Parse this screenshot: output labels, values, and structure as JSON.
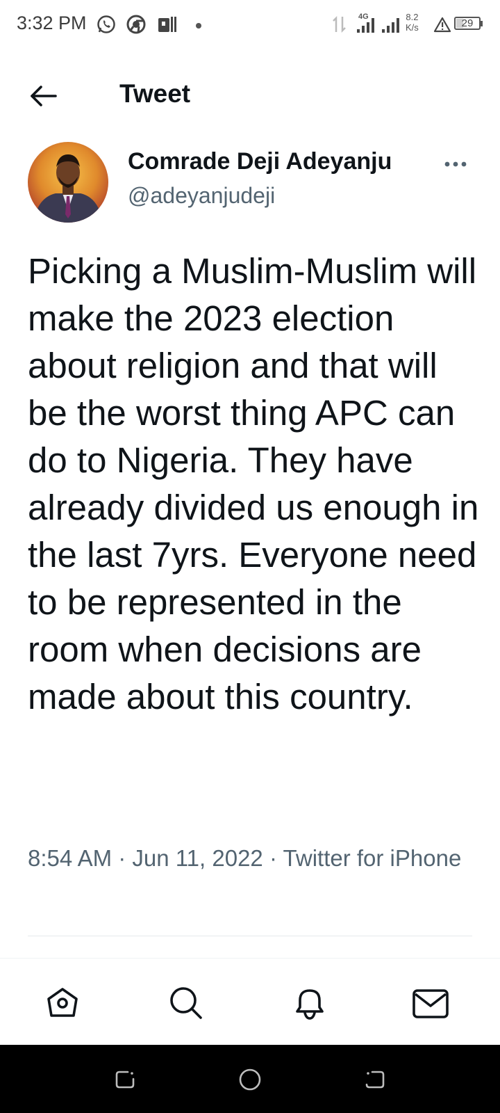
{
  "status_bar": {
    "time": "3:32 PM",
    "network_type": "4G",
    "speed_value": "8.2",
    "speed_unit": "K/s",
    "battery": "29",
    "battery_level": 0.29,
    "left_icons": [
      "whatsapp-icon",
      "chrome-icon",
      "app-icon",
      "dot-icon"
    ],
    "right_icons": [
      "data-arrows-icon",
      "signal-icon",
      "signal-icon",
      "warning-icon",
      "battery-icon"
    ]
  },
  "header": {
    "title": "Tweet",
    "back_icon": "arrow-left-icon"
  },
  "tweet": {
    "author_name": "Comrade Deji Adeyanju",
    "author_handle": "@adeyanjudeji",
    "text": "Picking a Muslim-Muslim will make the 2023 election about religion and that will be the worst thing APC can do to Nigeria. They have already divided us enough in the last 7yrs. Everyone need to be represented in the room when decisions are made about this country.",
    "time": "8:54 AM",
    "separator": " · ",
    "date": "Jun 11, 2022",
    "source": "Twitter for iPhone"
  },
  "bottom_nav": {
    "items": [
      "home-icon",
      "search-icon",
      "notifications-icon",
      "messages-icon"
    ]
  },
  "system_nav": {
    "items": [
      "recent-apps-icon",
      "home-circle-icon",
      "back-icon"
    ]
  },
  "colors": {
    "text_primary": "#0f1419",
    "text_secondary": "#536471",
    "divider": "#e6e9ec",
    "system_nav_bg": "#000000"
  }
}
